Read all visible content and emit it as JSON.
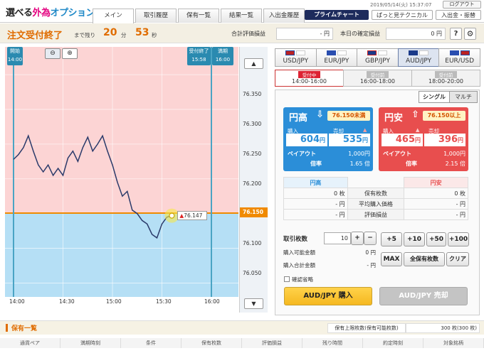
{
  "app": {
    "logo_part1": "選べる",
    "logo_part2": "外為",
    "logo_part3": "オプション"
  },
  "header": {
    "tabs": [
      "メイン",
      "取引履歴",
      "保有一覧",
      "結果一覧",
      "入出金履歴"
    ],
    "datetime": "2019/05/14(火) 15:37:07",
    "logout": "ログアウト",
    "prime_chart": "プライムチャート",
    "technical": "ぱっと見テクニカル",
    "deposit": "入出金・振替"
  },
  "status": {
    "title": "注文受付終了",
    "remaining_label": "まで残り",
    "minutes": "20",
    "min_unit": "分",
    "seconds": "53",
    "sec_unit": "秒",
    "valuation_label": "合計評価損益",
    "valuation_value": "- 円",
    "confirmed_label": "本日の確定損益",
    "confirmed_value": "0 円",
    "help": "?"
  },
  "chart": {
    "open_label": "開始",
    "open_time": "14:00",
    "end_label": "受付終了",
    "end_time": "15:58",
    "expiry_label": "満期",
    "expiry_time": "16:00",
    "x_ticks": [
      "14:00",
      "14:30",
      "15:00",
      "15:30",
      "16:00"
    ],
    "y_ticks": [
      "76.350",
      "76.300",
      "76.250",
      "76.200",
      "76.100",
      "76.050"
    ],
    "strike": "76.150",
    "current": "76.147"
  },
  "chart_data": {
    "type": "line",
    "x_unit": "minutes since 14:00",
    "xlim": [
      0,
      130
    ],
    "ylim": [
      76.03,
      76.39
    ],
    "x": [
      0,
      3,
      6,
      9,
      12,
      15,
      18,
      21,
      24,
      27,
      30,
      33,
      36,
      39,
      42,
      45,
      48,
      51,
      54,
      57,
      60,
      63,
      66,
      69,
      72,
      75,
      78,
      81,
      84,
      87,
      90,
      93,
      96
    ],
    "y": [
      76.228,
      76.235,
      76.245,
      76.262,
      76.24,
      76.22,
      76.21,
      76.22,
      76.205,
      76.215,
      76.205,
      76.23,
      76.24,
      76.225,
      76.245,
      76.26,
      76.24,
      76.25,
      76.262,
      76.24,
      76.22,
      76.195,
      76.175,
      76.182,
      76.155,
      76.15,
      76.14,
      76.135,
      76.12,
      76.115,
      76.135,
      76.145,
      76.147
    ],
    "strike": 76.15
  },
  "pairs": [
    {
      "label": "USD/JPY",
      "flag1": "#1f4aa8",
      "flag2": "#fff"
    },
    {
      "label": "EUR/JPY",
      "flag1": "#2a4eb0",
      "flag2": "#fff"
    },
    {
      "label": "GBP/JPY",
      "flag1": "#1a3a8a",
      "flag2": "#fff"
    },
    {
      "label": "AUD/JPY",
      "flag1": "#1a3a8a",
      "flag2": "#fff"
    },
    {
      "label": "EUR/USD",
      "flag1": "#2a4eb0",
      "flag2": "#1f4aa8"
    }
  ],
  "slots": [
    {
      "status": "受付中",
      "time": "14:00-16:00"
    },
    {
      "status": "受付前",
      "time": "16:00-18:00"
    },
    {
      "status": "受付前",
      "time": "18:00-20:00"
    }
  ],
  "mode": {
    "single": "シングル",
    "multi": "マルチ"
  },
  "high": {
    "title": "円高",
    "arrow": "⇩",
    "cond": "76.150未満",
    "buy_label": "購入",
    "buy": "604",
    "sell_label": "売却",
    "sell": "535",
    "unit": "円",
    "payout_label": "ペイアウト",
    "payout": "1,000円",
    "mult_label": "倍率",
    "mult": "1.65 倍"
  },
  "low": {
    "title": "円安",
    "arrow": "⇧",
    "cond": "76.150以上",
    "buy_label": "購入",
    "buy": "465",
    "sell_label": "売却",
    "sell": "396",
    "unit": "円",
    "payout_label": "ペイアウト",
    "payout": "1,000円",
    "mult_label": "倍率",
    "mult": "2.15 倍"
  },
  "positions": {
    "high_header": "円高",
    "low_header": "円安",
    "rows": [
      {
        "left": "0 枚",
        "label": "保有枚数",
        "right": "0 枚"
      },
      {
        "left": "- 円",
        "label": "平均購入価格",
        "right": "- 円"
      },
      {
        "left": "- 円",
        "label": "評価損益",
        "right": "- 円"
      }
    ]
  },
  "order": {
    "qty_label": "取引枚数",
    "qty": "10",
    "plus": "+",
    "minus": "−",
    "avail_label": "購入可能金額",
    "avail": "0 円",
    "total_label": "購入合計金額",
    "total": "- 円",
    "quick": [
      "+5",
      "+10",
      "+50",
      "+100"
    ],
    "max": "MAX",
    "all": "全保有枚数",
    "clear": "クリア",
    "confirm": "確認省略",
    "buy_btn": "AUD/JPY 購入",
    "sell_btn": "AUD/JPY 売却"
  },
  "held": {
    "title": "保有一覧",
    "limit_label": "保有上限枚数(保有可能枚数)",
    "limit_value": "300 枚(300 枚)",
    "columns": [
      "通貨ペア",
      "満期時刻",
      "条件",
      "保有枚数",
      "評価損益",
      "残り時間",
      "約定時刻",
      "対象銘柄"
    ]
  }
}
